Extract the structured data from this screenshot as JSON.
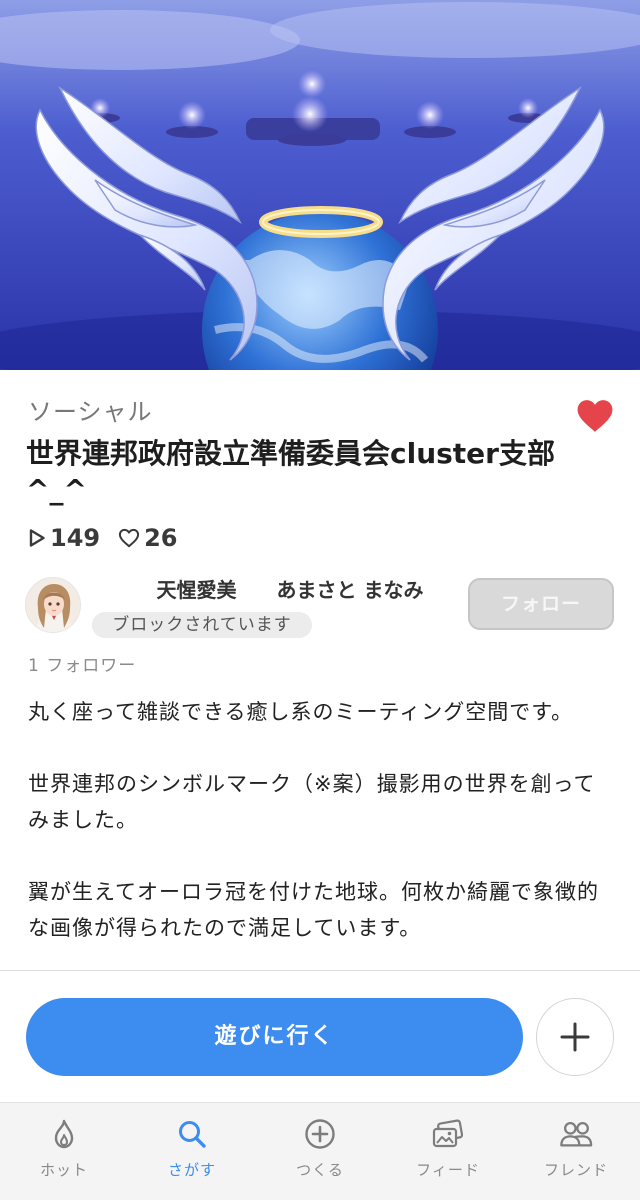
{
  "hero": {
    "image": "winged-earth-with-halo-world-banner"
  },
  "world": {
    "category": "ソーシャル",
    "title": "世界連邦政府設立準備委員会cluster支部^_^",
    "favorite_icon": "heart-icon",
    "favorited": true,
    "favorite_color": "#e5444a"
  },
  "stats": {
    "plays": "149",
    "likes": "26",
    "play_icon": "play-outline-icon",
    "like_icon": "heart-outline-icon"
  },
  "author": {
    "display_name": "天惺愛美　　あまさと まなみ",
    "avatar": "avatar",
    "blocked_badge": "ブロックされています",
    "follow_button": "フォロー",
    "followers": "1 フォロワー"
  },
  "description": [
    "丸く座って雑談できる癒し系のミーティング空間です。",
    "世界連邦のシンボルマーク（※案）撮影用の世界を創ってみました。",
    "翼が生えてオーロラ冠を付けた地球。何枚か綺麗で象徴的な画像が得られたので満足しています。"
  ],
  "actions": {
    "play_button": "遊びに行く",
    "add_icon": "plus-icon",
    "accent_color": "#3d8cf0"
  },
  "bottom_nav": {
    "active_index": 1,
    "items": [
      {
        "label": "ホット",
        "icon": "flame-icon"
      },
      {
        "label": "さがす",
        "icon": "search-icon"
      },
      {
        "label": "つくる",
        "icon": "plus-circle-icon"
      },
      {
        "label": "フィード",
        "icon": "feed-icon"
      },
      {
        "label": "フレンド",
        "icon": "friends-icon"
      }
    ]
  }
}
